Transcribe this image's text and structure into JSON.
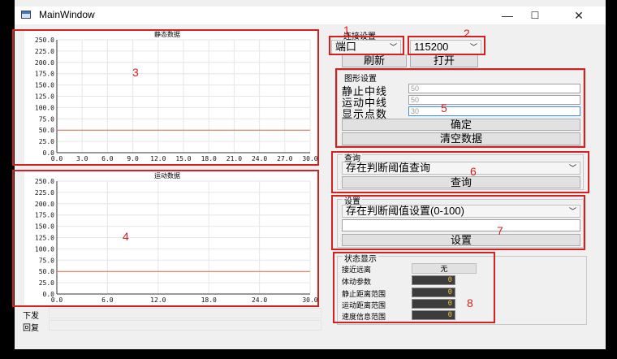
{
  "window": {
    "title": "MainWindow",
    "minimize": "—",
    "maximize": "☐",
    "close": "✕"
  },
  "charts": {
    "static": {
      "title": "静态数据"
    },
    "motion": {
      "title": "运动数据"
    }
  },
  "chart_data": [
    {
      "type": "line",
      "title": "静态数据",
      "x_ticks": [
        "0.0",
        "3.0",
        "6.0",
        "9.0",
        "12.0",
        "15.0",
        "18.0",
        "21.0",
        "24.0",
        "27.0",
        "30.0"
      ],
      "y_ticks": [
        "0.0",
        "25.0",
        "50.0",
        "75.0",
        "100.0",
        "125.0",
        "150.0",
        "175.0",
        "200.0",
        "225.0",
        "250.0"
      ],
      "xlim": [
        0,
        30
      ],
      "ylim": [
        0,
        250
      ],
      "grid": true,
      "series": [
        {
          "x": [
            0,
            30
          ],
          "values": [
            50,
            50
          ],
          "color": "#e8654c"
        }
      ]
    },
    {
      "type": "line",
      "title": "运动数据",
      "x_ticks": [
        "0.0",
        "6.0",
        "12.0",
        "18.0",
        "24.0",
        "30.0"
      ],
      "y_ticks": [
        "0.0",
        "25.0",
        "50.0",
        "75.0",
        "100.0",
        "125.0",
        "150.0",
        "175.0",
        "200.0",
        "225.0",
        "250.0"
      ],
      "xlim": [
        0,
        30
      ],
      "ylim": [
        0,
        250
      ],
      "grid": true,
      "series": [
        {
          "x": [
            0,
            30
          ],
          "values": [
            50,
            50
          ],
          "color": "#e8654c"
        }
      ]
    }
  ],
  "annotations": [
    "1",
    "2",
    "3",
    "4",
    "5",
    "6",
    "7",
    "8"
  ],
  "connection": {
    "title": "连接设置",
    "port_value": "端口",
    "baud_value": "115200",
    "refresh_label": "刷新",
    "open_label": "打开"
  },
  "graph_settings": {
    "title": "图形设置",
    "static_center_label": "静止中线",
    "static_center_value": "50",
    "motion_center_label": "运动中线",
    "motion_center_value": "50",
    "display_points_label": "显示点数",
    "display_points_value": "30",
    "confirm_label": "确定",
    "clear_label": "清空数据"
  },
  "query": {
    "title": "查询",
    "select_value": "存在判断阈值查询",
    "button_label": "查询"
  },
  "settings": {
    "title": "设置",
    "select_value": "存在判断阈值设置(0-100)",
    "input_value": "",
    "button_label": "设置"
  },
  "status": {
    "title": "状态显示",
    "rows": [
      {
        "label": "接近远离",
        "value": "无"
      },
      {
        "label": "体动参数",
        "value": "0"
      },
      {
        "label": "静止距离范围",
        "value": "0"
      },
      {
        "label": "运动距离范围",
        "value": "0"
      },
      {
        "label": "速度信息范围",
        "value": "0"
      }
    ]
  },
  "tx": {
    "send_label": "下发",
    "reply_label": "回复"
  }
}
